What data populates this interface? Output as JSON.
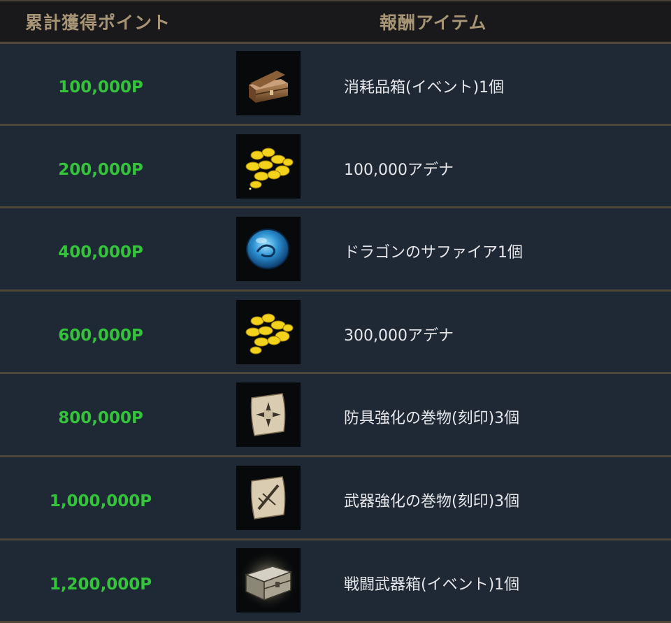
{
  "header": {
    "points_label": "累計獲得ポイント",
    "reward_label": "報酬アイテム"
  },
  "rows": [
    {
      "points": "100,000P",
      "item": "消耗品箱(イベント)1個",
      "icon": "wooden-chest-icon"
    },
    {
      "points": "200,000P",
      "item": "100,000アデナ",
      "icon": "gold-coins-icon"
    },
    {
      "points": "400,000P",
      "item": "ドラゴンのサファイア1個",
      "icon": "blue-sapphire-icon"
    },
    {
      "points": "600,000P",
      "item": "300,000アデナ",
      "icon": "gold-coins-icon"
    },
    {
      "points": "800,000P",
      "item": "防具強化の巻物(刻印)3個",
      "icon": "armor-scroll-icon"
    },
    {
      "points": "1,000,000P",
      "item": "武器強化の巻物(刻印)3個",
      "icon": "weapon-scroll-icon"
    },
    {
      "points": "1,200,000P",
      "item": "戦闘武器箱(イベント)1個",
      "icon": "silver-chest-icon"
    }
  ],
  "colors": {
    "points_text": "#34c33b",
    "header_text": "#a89576",
    "item_text": "#e6e7ea",
    "row_bg": "#1f2936",
    "separator": "#4f4637"
  }
}
